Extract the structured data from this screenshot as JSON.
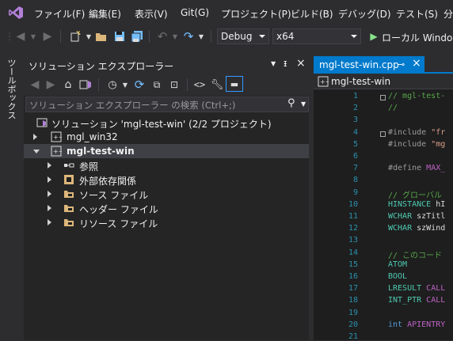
{
  "menu": {
    "items": [
      "ファイル(F)",
      "編集(E)",
      "表示(V)",
      "Git(G)",
      "プロジェクト(P)",
      "ビルド(B)",
      "デバッグ(D)",
      "テスト(S)",
      "分"
    ]
  },
  "toolbar": {
    "config": "Debug",
    "platform": "x64",
    "run_label": "ローカル Windows"
  },
  "toolbox": {
    "label": "ツールボックス"
  },
  "solution_explorer": {
    "title": "ソリューション エクスプローラー",
    "search_placeholder": "ソリューション エクスプローラー の検索 (Ctrl+;)",
    "tree": [
      {
        "label": "ソリューション 'mgl-test-win' (2/2 プロジェクト)",
        "icon": "solution-icon",
        "expander": "none"
      },
      {
        "label": "mgl_win32",
        "icon": "project-icon",
        "expander": "collapsed"
      },
      {
        "label": "mgl-test-win",
        "icon": "project-icon",
        "expander": "expanded",
        "selected": true
      },
      {
        "label": "参照",
        "icon": "references-icon",
        "expander": "collapsed"
      },
      {
        "label": "外部依存関係",
        "icon": "external-deps-icon",
        "expander": "collapsed"
      },
      {
        "label": "ソース ファイル",
        "icon": "folder-icon",
        "expander": "collapsed"
      },
      {
        "label": "ヘッダー ファイル",
        "icon": "folder-icon",
        "expander": "collapsed"
      },
      {
        "label": "リソース ファイル",
        "icon": "folder-icon",
        "expander": "collapsed"
      }
    ]
  },
  "editor": {
    "tab_title": "mgl-test-win.cpp",
    "nav_scope": "mgl-test-win",
    "lines": [
      {
        "n": "1",
        "tokens": [
          {
            "t": "// mgl-test-",
            "c": "c-comment"
          }
        ]
      },
      {
        "n": "2",
        "tokens": [
          {
            "t": "//",
            "c": "c-comment"
          }
        ]
      },
      {
        "n": "3",
        "tokens": []
      },
      {
        "n": "4",
        "tokens": [
          {
            "t": "#include ",
            "c": "c-pre"
          },
          {
            "t": "\"fr",
            "c": "c-str"
          }
        ]
      },
      {
        "n": "5",
        "tokens": [
          {
            "t": "#include ",
            "c": "c-pre"
          },
          {
            "t": "\"mg",
            "c": "c-str"
          }
        ]
      },
      {
        "n": "6",
        "tokens": []
      },
      {
        "n": "7",
        "tokens": [
          {
            "t": "#define ",
            "c": "c-pre"
          },
          {
            "t": "MAX_",
            "c": "c-macro"
          }
        ]
      },
      {
        "n": "8",
        "tokens": []
      },
      {
        "n": "9",
        "tokens": [
          {
            "t": "// グローバル",
            "c": "c-comment"
          }
        ]
      },
      {
        "n": "10",
        "tokens": [
          {
            "t": "HINSTANCE ",
            "c": "c-type"
          },
          {
            "t": "hI",
            "c": "c-text"
          }
        ]
      },
      {
        "n": "11",
        "tokens": [
          {
            "t": "WCHAR ",
            "c": "c-type"
          },
          {
            "t": "szTitl",
            "c": "c-text"
          }
        ]
      },
      {
        "n": "12",
        "tokens": [
          {
            "t": "WCHAR ",
            "c": "c-type"
          },
          {
            "t": "szWind",
            "c": "c-text"
          }
        ]
      },
      {
        "n": "13",
        "tokens": []
      },
      {
        "n": "14",
        "tokens": [
          {
            "t": "// このコード",
            "c": "c-comment"
          }
        ]
      },
      {
        "n": "15",
        "tokens": [
          {
            "t": "ATOM",
            "c": "c-type"
          }
        ]
      },
      {
        "n": "16",
        "tokens": [
          {
            "t": "BOOL",
            "c": "c-type"
          }
        ]
      },
      {
        "n": "17",
        "tokens": [
          {
            "t": "LRESULT ",
            "c": "c-type"
          },
          {
            "t": "CALL",
            "c": "c-macro"
          }
        ]
      },
      {
        "n": "18",
        "tokens": [
          {
            "t": "INT_PTR ",
            "c": "c-type"
          },
          {
            "t": "CALL",
            "c": "c-macro"
          }
        ]
      },
      {
        "n": "19",
        "tokens": []
      },
      {
        "n": "20",
        "tokens": [
          {
            "t": "int ",
            "c": "c-kw"
          },
          {
            "t": "APIENTRY",
            "c": "c-macro"
          }
        ]
      },
      {
        "n": "21",
        "tokens": []
      }
    ]
  },
  "colors": {
    "accent": "#007acc",
    "run_green": "#8ae28a",
    "vs_purple": "#b180d7",
    "save_blue": "#75beff"
  }
}
